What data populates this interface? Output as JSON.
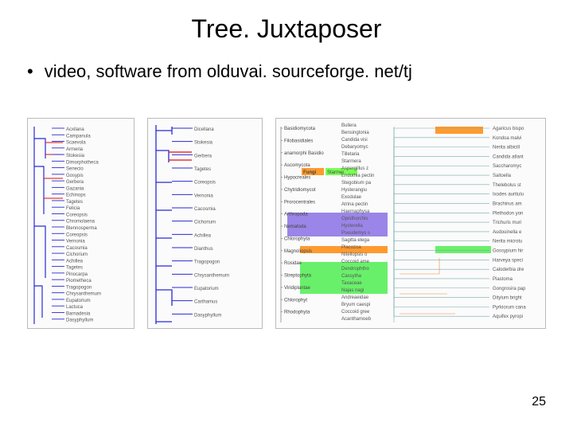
{
  "title": "Tree. Juxtaposer",
  "bullet": "video, software from olduvai. sourceforge. net/tj",
  "page_number": "25",
  "panel1_labels": [
    "Acxilana",
    "Campanula",
    "Scaevola",
    "Armeria",
    "Stokesia",
    "Dimorphotheca",
    "Senecio",
    "Gosypis",
    "Gerbera",
    "Gazania",
    "Echinops",
    "Tagetes",
    "Felicia",
    "Coreopsis",
    "Chromolaena",
    "Blennosperma",
    "Coreopsis",
    "Vernonia",
    "Cacosmia",
    "Cichorium",
    "Achillea",
    "Tagetes",
    "Pinocarpa",
    "Piometheca",
    "Tragopogon",
    "Chrysanthemum",
    "Eupatorium",
    "Lactuca",
    "Barnadesia",
    "Dasyphyllum"
  ],
  "panel2_labels": [
    "Dicellana",
    "Stokesia",
    "Gerbera",
    "Tagetes",
    "Coreopsis",
    "Vernonia",
    "Cacosmia",
    "Cichorium",
    "Achillea",
    "Dianthus",
    "Tragopogon",
    "Chrysanthemum",
    "Eupatorium",
    "Carthamus",
    "Dasyphyllum"
  ],
  "panel3_left": [
    "Basidiomycota",
    "Filobasidiales",
    "anamorphi Basidio",
    "Ascomycota",
    "Hypocreales",
    "Chytridiomycot",
    "Prorocentrales",
    "Arthropoda",
    "Nematoda",
    "Chlorophyta",
    "Magnoliopsis",
    "Rosidae",
    "Streptophyta",
    "Viridiplantae",
    "Chlorophyt",
    "Rhodophyta"
  ],
  "panel3_mid": [
    "Bullera",
    "Bensingtonia",
    "Candida visi",
    "Debaryomyc",
    "Tilletaria",
    "Starmera",
    "Aspergillus z",
    "Endothia pectin",
    "Stegobium pa",
    "Hysterangiu",
    "Exodulae",
    "Atrina pectin",
    "Haemaphysa",
    "Opisthorchis",
    "Hysterella",
    "Pseudemys s",
    "Sagitta elega",
    "Placozoa",
    "Nitellopsis o",
    "Coccoid ame",
    "Dendrophtho",
    "Cassytha",
    "Taxaceae",
    "Najas nagi",
    "Andreaeidae",
    "Bryum caespi",
    "Coccoid gree",
    "Acanthamoeb"
  ],
  "panel3_right": [
    "Agaricus bispo",
    "Kondoa malvi",
    "Nerita albicill",
    "Candida atlant",
    "Saccharomyc",
    "Saitoella",
    "Thelebolus st",
    "Ixodes auritulu",
    "Brachinus am",
    "Plethodon yon",
    "Trichuris muri",
    "Audouinella e",
    "Nerita microtu",
    "Gossypium hir",
    "Harveya speci",
    "Caloderbia dre",
    "Piastoma",
    "Gongrosira pap",
    "Ditylum bright",
    "Pyrkiorum cana",
    "Aquifex pyropi"
  ],
  "highlight_fungi": "Fungi",
  "highlight_starmer": "Starmer"
}
